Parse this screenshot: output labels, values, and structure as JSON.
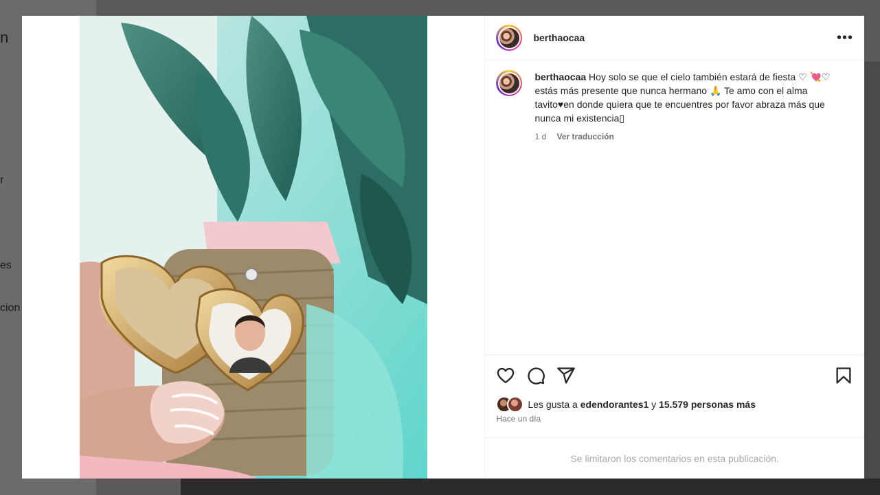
{
  "background": {
    "fragments": [
      "n",
      "r",
      "es",
      "cion"
    ]
  },
  "post": {
    "username": "berthaocaa",
    "caption": {
      "username": "berthaocaa",
      "text": "Hoy solo se que el cielo también estará de fiesta ♡ 💘♡  estás más presente que nunca hermano 🙏 Te amo con el alma tavito♥en donde quiera que te encuentres por favor abraza más que nunca mi existencia▯"
    },
    "age": "1 d",
    "translate_label": "Ver traducción",
    "likes": {
      "prefix": "Les gusta a",
      "user": "edendorantes1",
      "conjunction": "y",
      "others": "15.579 personas más"
    },
    "timestamp": "Hace un día",
    "comments_limited": "Se limitaron los comentarios en esta publicación.",
    "more_label": "•••"
  },
  "icons": [
    "heart-icon",
    "comment-icon",
    "share-icon",
    "bookmark-icon",
    "more-options-icon"
  ],
  "colors": {
    "text": "#262626",
    "secondary": "#737373",
    "muted": "#a8a8a8",
    "border": "#efefef"
  }
}
